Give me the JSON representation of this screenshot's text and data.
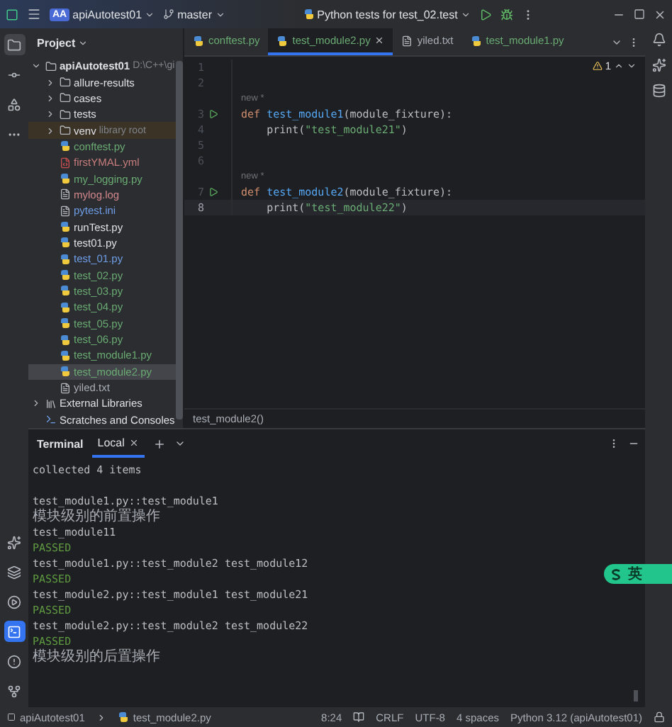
{
  "title_bar": {
    "project_badge": "AA",
    "project": "apiAutotest01",
    "branch": "master",
    "run_config": "Python tests for test_02.test"
  },
  "tool_windows": {
    "top": [
      {
        "kind": "project",
        "selected": true
      },
      {
        "kind": "commit",
        "selected": false
      },
      {
        "kind": "structure",
        "selected": false
      },
      {
        "kind": "more",
        "selected": false
      }
    ],
    "bottom": [
      {
        "kind": "python-console",
        "selected": false
      },
      {
        "kind": "services",
        "selected": false
      },
      {
        "kind": "run",
        "selected": false
      },
      {
        "kind": "terminal",
        "selected": true
      },
      {
        "kind": "problems",
        "selected": false
      },
      {
        "kind": "git",
        "selected": false
      }
    ]
  },
  "project_panel": {
    "title": "Project",
    "tree": [
      {
        "name": "apiAutotest01",
        "hint": "D:\\C++\\gi",
        "kind": "root",
        "expanded": true,
        "selected": false,
        "color": "#dfe1e5",
        "children": [
          {
            "name": "allure-results",
            "kind": "folder",
            "expanded": false,
            "selected": false,
            "color": "#dfe1e5"
          },
          {
            "name": "cases",
            "kind": "folder",
            "expanded": false,
            "selected": false,
            "color": "#dfe1e5"
          },
          {
            "name": "tests",
            "kind": "folder",
            "expanded": false,
            "selected": false,
            "color": "#dfe1e5"
          },
          {
            "name": "venv",
            "hint": "library root",
            "kind": "library-root",
            "expanded": false,
            "selected": false,
            "color": "#dfe1e5"
          },
          {
            "name": "conftest.py",
            "kind": "python",
            "selected": false,
            "color": "#6aab73"
          },
          {
            "name": "firstYMAL.yml",
            "kind": "yaml",
            "selected": false,
            "color": "#c77d7d"
          },
          {
            "name": "my_logging.py",
            "kind": "python",
            "selected": false,
            "color": "#6aab73"
          },
          {
            "name": "mylog.log",
            "kind": "text",
            "selected": false,
            "color": "#d3888e"
          },
          {
            "name": "pytest.ini",
            "kind": "ini",
            "selected": false,
            "color": "#6f9ee8"
          },
          {
            "name": "runTest.py",
            "kind": "python",
            "selected": false,
            "color": "#dfe1e5"
          },
          {
            "name": "test01.py",
            "kind": "python",
            "selected": false,
            "color": "#dfe1e5"
          },
          {
            "name": "test_01.py",
            "kind": "python",
            "selected": false,
            "color": "#6f9ee8"
          },
          {
            "name": "test_02.py",
            "kind": "python",
            "selected": false,
            "color": "#6aab73"
          },
          {
            "name": "test_03.py",
            "kind": "python",
            "selected": false,
            "color": "#6aab73"
          },
          {
            "name": "test_04.py",
            "kind": "python",
            "selected": false,
            "color": "#6aab73"
          },
          {
            "name": "test_05.py",
            "kind": "python",
            "selected": false,
            "color": "#6aab73"
          },
          {
            "name": "test_06.py",
            "kind": "python",
            "selected": false,
            "color": "#6aab73"
          },
          {
            "name": "test_module1.py",
            "kind": "python",
            "selected": false,
            "color": "#6aab73"
          },
          {
            "name": "test_module2.py",
            "kind": "python",
            "selected": true,
            "color": "#6aab73"
          },
          {
            "name": "yiled.txt",
            "kind": "text",
            "selected": false,
            "color": "#a8adb5"
          }
        ]
      },
      {
        "name": "External Libraries",
        "kind": "libraries",
        "expanded": false,
        "selected": false,
        "color": "#dfe1e5"
      },
      {
        "name": "Scratches and Consoles",
        "kind": "scratches",
        "selected": false,
        "color": "#dfe1e5"
      }
    ]
  },
  "editor": {
    "tabs": [
      {
        "label": "conftest.py",
        "kind": "python",
        "selected": false,
        "color": "#6aab73"
      },
      {
        "label": "test_module2.py",
        "kind": "python",
        "selected": true,
        "color": "#6aab73"
      },
      {
        "label": "yiled.txt",
        "kind": "text",
        "selected": false,
        "color": "#a8adb5"
      },
      {
        "label": "test_module1.py",
        "kind": "python",
        "selected": false,
        "color": "#6aab73"
      }
    ],
    "warnings": "1",
    "lines": [
      {
        "kind": "code",
        "number": "1",
        "runnable": false,
        "current": false
      },
      {
        "kind": "code",
        "number": "2",
        "runnable": false,
        "current": false
      },
      {
        "kind": "hint",
        "text": "new *"
      },
      {
        "kind": "code",
        "number": "3",
        "runnable": true,
        "current": false,
        "tokens": [
          {
            "kind": "keyword",
            "text": "def"
          },
          {
            "kind": "function",
            "text": "test_module1"
          },
          {
            "kind": "plain",
            "text": "(module_fixture):"
          }
        ]
      },
      {
        "kind": "code",
        "number": "4",
        "runnable": false,
        "current": false,
        "tokens": [
          {
            "kind": "indent"
          },
          {
            "kind": "plain",
            "text": "print("
          },
          {
            "kind": "string",
            "text": "\"test_module21\""
          },
          {
            "kind": "plain",
            "text": ")"
          }
        ]
      },
      {
        "kind": "code",
        "number": "5",
        "runnable": false,
        "current": false
      },
      {
        "kind": "code",
        "number": "6",
        "runnable": false,
        "current": false
      },
      {
        "kind": "hint",
        "text": "new *"
      },
      {
        "kind": "code",
        "number": "7",
        "runnable": true,
        "current": false,
        "tokens": [
          {
            "kind": "keyword",
            "text": "def"
          },
          {
            "kind": "function",
            "text": "test_module2"
          },
          {
            "kind": "plain",
            "text": "(module_fixture):"
          }
        ]
      },
      {
        "kind": "code",
        "number": "8",
        "runnable": false,
        "current": true,
        "tokens": [
          {
            "kind": "indent"
          },
          {
            "kind": "plain",
            "text": "print("
          },
          {
            "kind": "string",
            "text": "\"test_module22\""
          },
          {
            "kind": "plain",
            "text": ")"
          }
        ]
      }
    ],
    "breadcrumb": "test_module2()"
  },
  "terminal": {
    "title": "Terminal",
    "tabs": [
      {
        "label": "Local",
        "selected": true
      }
    ],
    "lines": [
      {
        "kind": "plain",
        "text": "collected 4 items"
      },
      {
        "kind": "blank"
      },
      {
        "kind": "plain",
        "text": "test_module1.py::test_module1"
      },
      {
        "kind": "cjk",
        "text": "模块级别的前置操作"
      },
      {
        "kind": "plain",
        "text": "test_module11"
      },
      {
        "kind": "passed",
        "text": "PASSED"
      },
      {
        "kind": "plain",
        "text": "test_module1.py::test_module2 test_module12"
      },
      {
        "kind": "passed",
        "text": "PASSED"
      },
      {
        "kind": "plain",
        "text": "test_module2.py::test_module1 test_module21"
      },
      {
        "kind": "passed",
        "text": "PASSED"
      },
      {
        "kind": "plain",
        "text": "test_module2.py::test_module2 test_module22"
      },
      {
        "kind": "passed",
        "text": "PASSED"
      },
      {
        "kind": "cjk",
        "text": "模块级别的后置操作"
      }
    ]
  },
  "ime": {
    "label": "英"
  },
  "status_bar": {
    "path": [
      "apiAutotest01",
      "test_module2.py"
    ],
    "position": "8:24",
    "line_ending": "CRLF",
    "encoding": "UTF-8",
    "indent": "4 spaces",
    "interpreter": "Python 3.12 (apiAutotest01)"
  }
}
